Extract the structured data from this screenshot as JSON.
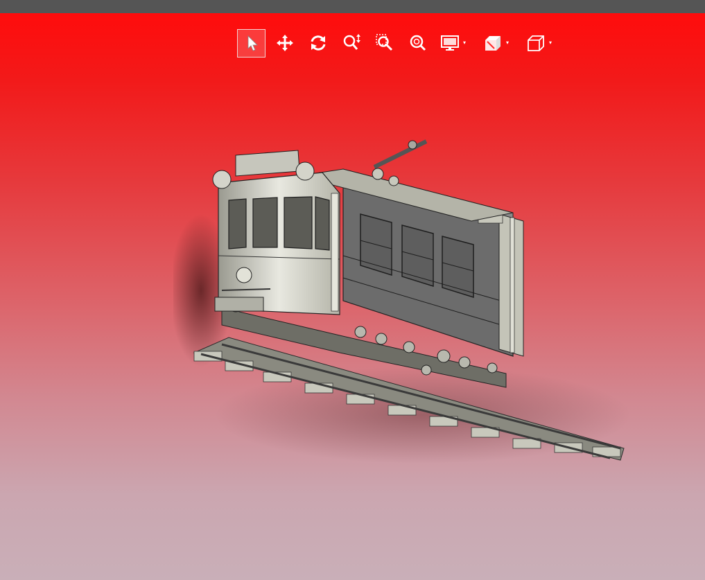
{
  "window": {
    "titlebar_color": "#555555"
  },
  "viewport": {
    "background_top": "#ff0c0c",
    "background_bottom": "#c9afb8",
    "model": "tram-on-rails-3d-model"
  },
  "toolbar": {
    "tools": [
      {
        "id": "select",
        "icon": "cursor-arrow-icon",
        "active": true
      },
      {
        "id": "pan",
        "icon": "move-arrows-icon",
        "active": false
      },
      {
        "id": "rotate",
        "icon": "rotate-icon",
        "active": false
      },
      {
        "id": "zoom",
        "icon": "zoom-vertical-icon",
        "active": false
      },
      {
        "id": "zoom-window",
        "icon": "zoom-window-icon",
        "active": false
      },
      {
        "id": "zoom-fit",
        "icon": "zoom-fit-icon",
        "active": false
      },
      {
        "id": "display",
        "icon": "monitor-icon",
        "has_dropdown": true
      },
      {
        "id": "section",
        "icon": "section-cube-icon",
        "has_dropdown": true
      },
      {
        "id": "view-orientation",
        "icon": "cube-view-icon",
        "has_dropdown": true
      }
    ],
    "dropdown_caret": "▾"
  }
}
